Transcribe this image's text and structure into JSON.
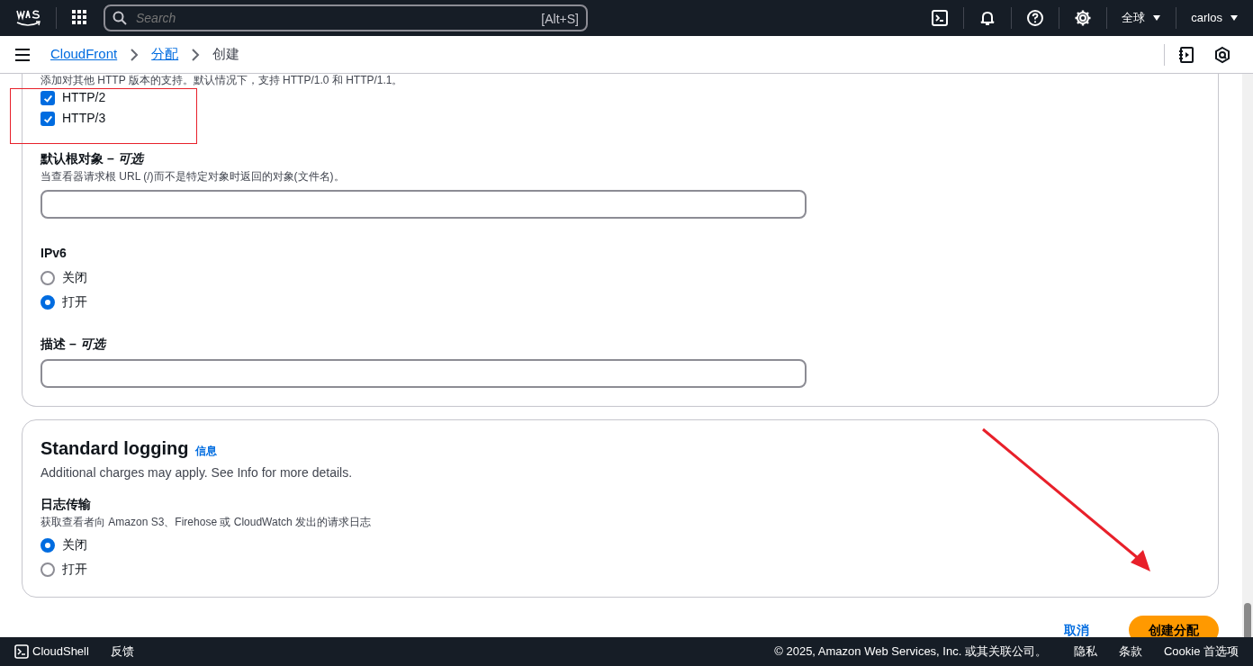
{
  "top_nav": {
    "search_placeholder": "Search",
    "search_shortcut": "[Alt+S]",
    "region": "全球",
    "user": "carlos"
  },
  "breadcrumbs": [
    {
      "label": "CloudFront",
      "link": true
    },
    {
      "label": "分配",
      "link": true
    },
    {
      "label": "创建",
      "link": false
    }
  ],
  "settings_card": {
    "http_versions": {
      "description": "添加对其他 HTTP 版本的支持。默认情况下，支持 HTTP/1.0 和 HTTP/1.1。",
      "options": [
        {
          "label": "HTTP/2",
          "checked": true
        },
        {
          "label": "HTTP/3",
          "checked": true
        }
      ]
    },
    "default_root_object": {
      "label": "默认根对象 – *可选*",
      "description": "当查看器请求根 URL (/)而不是特定对象时返回的对象(文件名)。"
    },
    "ipv6": {
      "label": "IPv6",
      "options": [
        {
          "label": "关闭",
          "selected": false
        },
        {
          "label": "打开",
          "selected": true
        }
      ]
    },
    "description_field": {
      "label": "描述 – *可选*"
    }
  },
  "logging_card": {
    "title": "Standard logging",
    "info_link": "信息",
    "subtitle": "Additional charges may apply. See Info for more details.",
    "delivery": {
      "label": "日志传输",
      "description": "获取查看者向 Amazon S3、Firehose 或 CloudWatch 发出的请求日志",
      "options": [
        {
          "label": "关闭",
          "selected": true
        },
        {
          "label": "打开",
          "selected": false
        }
      ]
    }
  },
  "actions": {
    "cancel": "取消",
    "submit": "创建分配"
  },
  "footer": {
    "cloudshell": "CloudShell",
    "feedback": "反馈",
    "copyright": "© 2025, Amazon Web Services, Inc. 或其关联公司。",
    "links": [
      "隐私",
      "条款",
      "Cookie 首选项"
    ]
  },
  "annotations": [
    {
      "kind": "box"
    },
    {
      "kind": "arrow"
    }
  ]
}
